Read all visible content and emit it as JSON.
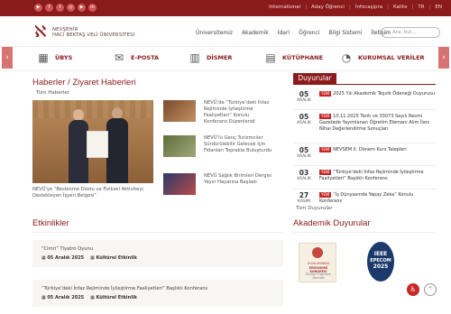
{
  "topbar": {
    "social": [
      "yt-icon",
      "f",
      "t",
      "ig",
      "yt",
      "in"
    ],
    "links": [
      "International",
      "Aday Öğrenci",
      "İnfocaşipra",
      "Kalite",
      "TR",
      "EN"
    ]
  },
  "logo": {
    "line1": "NEVŞEHİR",
    "line2": "HACI BEKTAŞ VELİ ÜNİVERSİTESİ"
  },
  "nav": [
    "Üniversitemiz",
    "Akademik",
    "İdari",
    "Öğrenci",
    "Bilgi Sistemi",
    "İletişim"
  ],
  "search": {
    "placeholder": "Ara, bul..."
  },
  "quick": [
    {
      "label": "ÜBYS",
      "icon": "grid-icon"
    },
    {
      "label": "E-POSTA",
      "icon": "mail-icon"
    },
    {
      "label": "DİSMER",
      "icon": "building-icon"
    },
    {
      "label": "KÜTÜPHANE",
      "icon": "library-icon"
    },
    {
      "label": "KURUMSAL VERİLER",
      "icon": "chart-icon"
    }
  ],
  "news": {
    "heading": "Haberler / Ziyaret Haberleri",
    "all": "Tüm Haberler",
    "featured_caption": "NEVÜ'ye “Beslenme Dostu ve Fiziksel Aktiviteyi Destekleyen İşyeri Belgesi”",
    "items": [
      "NEVÜ’de “Türkiye’deki İnfaz Rejiminde İyileştirme Faaliyetleri” Konulu Konferans Düzenlendi",
      "NEVÜ’lü Genç Turizmciler Sürdürülebilir Gelecek İçin Fidanları Toprakla Buluşturdu",
      "NEVÜ Sağlık Birimleri Dergisi Yayın Hayatına Başladı"
    ]
  },
  "announcements": {
    "heading": "Duyurular",
    "badge": "YENİ",
    "items": [
      {
        "day": "05",
        "month": "ARALIK",
        "text": "2025 Yılı Akademik Teşvik Ödeneği Duyurusu"
      },
      {
        "day": "05",
        "month": "ARALIK",
        "text": "10.11.2025 Tarih ve 33073 Sayılı Resmi Gazetede Yayımlanan Öğretim Elemanı Alım İlanı Nihai Değerlendirme Sonuçları"
      },
      {
        "day": "05",
        "month": "ARALIK",
        "text": "NEVSEM II. Dönem Kurs Talepleri"
      },
      {
        "day": "03",
        "month": "ARALIK",
        "text": "“Türkiye’deki İnfaz Rejiminde İyileştirme Faaliyetleri” Başlıklı Konferans"
      },
      {
        "day": "27",
        "month": "KASIM",
        "text": "“İş Dünyasında Yapay Zeka” Konulu Konferans"
      }
    ],
    "all": "Tüm Duyurular"
  },
  "events": {
    "heading": "Etkinlikler",
    "items": [
      {
        "title": "“Cimri” Tiyatro Oyunu",
        "date": "05 Aralık 2025",
        "type": "Kültürel Etkinlik"
      },
      {
        "title": "“Türkiye’deki İnfaz Rejiminde İyileştirme Faaliyetleri” Başlıklı Konferans",
        "date": "05 Aralık 2025",
        "type": "Kültürel Etkinlik"
      }
    ]
  },
  "academic": {
    "heading": "Akademik Duyurular",
    "poster1": [
      "ULUSLARARASI",
      "ERGONOMİ KONGRESİ",
      "Türkiye Ergonomi Derneği"
    ],
    "poster2": [
      "IEEE",
      "EPECOM",
      "2025"
    ]
  }
}
